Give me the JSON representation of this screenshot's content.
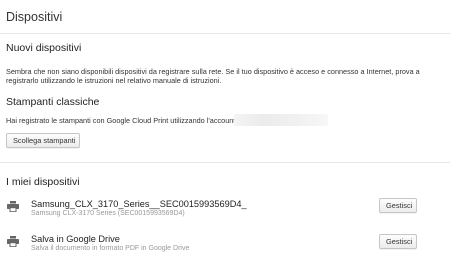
{
  "page_title": "Dispositivi",
  "new_devices": {
    "title": "Nuovi dispositivi",
    "description_line1": "Sembra che non siano disponibili dispositivi da registrare sulla rete. Se il tuo dispositivo è acceso e connesso a Internet, prova a",
    "description_line2": "registrarlo utilizzando le istruzioni nel relativo manuale di istruzioni."
  },
  "classic_printers": {
    "title": "Stampanti classiche",
    "description": "Hai registrato le stampanti con Google Cloud Print utilizzando l'account",
    "disconnect_label": "Scollega stampanti"
  },
  "my_devices": {
    "title": "I miei dispositivi",
    "items": [
      {
        "name": "Samsung_CLX_3170_Series__SEC0015993569D4_",
        "subtitle": "Samsung CLX-3170 Series (SEC0015993569D4)",
        "button_label": "Gestisci",
        "icon": "printer-icon"
      },
      {
        "name": "Salva in Google Drive",
        "subtitle": "Salva il documento in formato PDF in Google Drive",
        "button_label": "Gestisci",
        "icon": "printer-icon"
      }
    ]
  }
}
